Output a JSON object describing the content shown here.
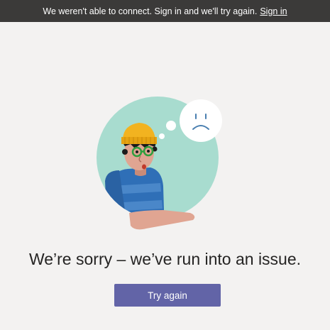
{
  "banner": {
    "message": "We weren't able to connect. Sign in and we'll try again.",
    "link_label": "Sign in"
  },
  "illustration": {
    "figure_icon": "person-thinking-sad-illustration",
    "thought_icon": "sad-face-thought-bubble-icon"
  },
  "main": {
    "headline": "We’re sorry – we’ve run into an issue.",
    "try_again_label": "Try again"
  },
  "colors": {
    "banner_bg": "#3b3a39",
    "page_bg": "#f3f2f1",
    "button_bg": "#6264a7",
    "circle": "#a8dccf",
    "hat": "#f2b320",
    "shirt": "#2f6fb7",
    "skin": "#e0a592"
  }
}
